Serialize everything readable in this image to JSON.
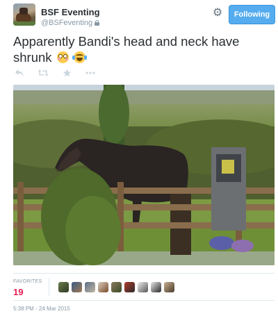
{
  "tweet": {
    "author": {
      "display_name": "BSF Eventing",
      "screen_name": "@BSFeventing",
      "protected_icon": "lock-icon"
    },
    "settings_icon": "gear-icon",
    "follow_button_label": "Following",
    "text": "Apparently Bandi's head and neck have shrunk",
    "emojis": [
      "flushed-face",
      "face-with-tears-of-joy"
    ],
    "actions": [
      "reply-icon",
      "retweet-icon",
      "favorite-icon",
      "more-icon"
    ],
    "stats": {
      "favorites_label": "FAVORITES",
      "favorites_count": "19"
    },
    "favoriter_avatar_count": 9,
    "timestamp": "5:38 PM - 24 Mar 2015"
  },
  "colors": {
    "follow_button": "#55acee",
    "favorites_count": "#e81c4f",
    "muted_text": "#8899a6",
    "action_icons": "#ccd6dd"
  }
}
